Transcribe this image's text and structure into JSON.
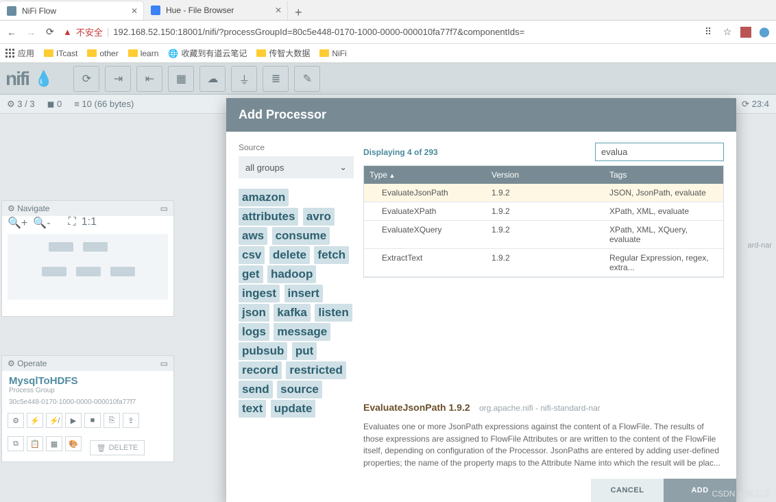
{
  "browser": {
    "tabs": [
      {
        "title": "NiFi Flow",
        "active": true
      },
      {
        "title": "Hue - File Browser",
        "active": false
      }
    ],
    "insecure": "不安全",
    "url": "192.168.52.150:18001/nifi/?processGroupId=80c5e448-0170-1000-0000-000010fa77f7&componentIds=",
    "bookmarks": {
      "apps": "应用",
      "items": [
        "ITcast",
        "other",
        "learn"
      ],
      "youdao": "收藏到有道云笔记",
      "items2": [
        "传智大数据",
        "NiFi"
      ]
    }
  },
  "nifi": {
    "logo": "nifi",
    "status": {
      "running": "3 / 3",
      "stopped": "0",
      "queued": "10 (66 bytes)",
      "time": "23:4"
    },
    "navigate": {
      "title": "Navigate"
    },
    "operate": {
      "title": "Operate",
      "group": "MysqlToHDFS",
      "subtitle": "Process Group",
      "id": "30c5e448-0170-1000-0000-000010fa77f7",
      "delete": "DELETE"
    },
    "nar_hint": "ard-nar"
  },
  "modal": {
    "title": "Add Processor",
    "source_label": "Source",
    "source_value": "all groups",
    "tags": [
      "amazon",
      "attributes",
      "avro",
      "aws",
      "consume",
      "csv",
      "delete",
      "fetch",
      "get",
      "hadoop",
      "ingest",
      "insert",
      "json",
      "kafka",
      "listen",
      "logs",
      "message",
      "pubsub",
      "put",
      "record",
      "restricted",
      "send",
      "source",
      "text",
      "update"
    ],
    "displaying": "Displaying 4 of 293",
    "search": "evalua",
    "columns": {
      "type": "Type",
      "version": "Version",
      "tags": "Tags"
    },
    "rows": [
      {
        "type": "EvaluateJsonPath",
        "version": "1.9.2",
        "tags": "JSON, JsonPath, evaluate",
        "selected": true
      },
      {
        "type": "EvaluateXPath",
        "version": "1.9.2",
        "tags": "XPath, XML, evaluate"
      },
      {
        "type": "EvaluateXQuery",
        "version": "1.9.2",
        "tags": "XPath, XML, XQuery, evaluate"
      },
      {
        "type": "ExtractText",
        "version": "1.9.2",
        "tags": "Regular Expression, regex, extra..."
      }
    ],
    "detail": {
      "title": "EvaluateJsonPath 1.9.2",
      "bundle": "org.apache.nifi - nifi-standard-nar",
      "text": "Evaluates one or more JsonPath expressions against the content of a FlowFile. The results of those expressions are assigned to FlowFile Attributes or are written to the content of the FlowFile itself, depending on configuration of the Processor. JsonPaths are entered by adding user-defined properties; the name of the property maps to the Attribute Name into which the result will be plac..."
    },
    "cancel": "CANCEL",
    "add": "ADD"
  },
  "watermark": "CSDN @脑瓜凉"
}
